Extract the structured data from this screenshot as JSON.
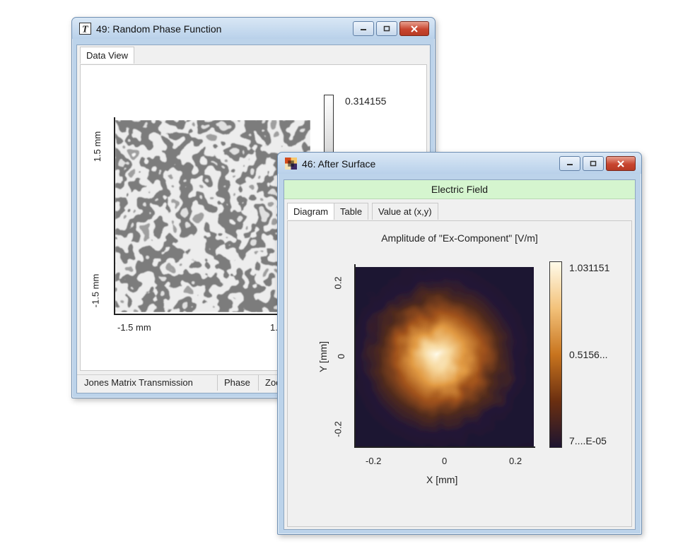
{
  "window_back": {
    "title": "49: Random Phase Function",
    "tab": "Data View",
    "colorbar_max": "0.314155",
    "y_tick_top": "1.5 mm",
    "y_tick_bottom": "-1.5 mm",
    "x_tick_left": "-1.5 mm",
    "x_tick_right": "1.5",
    "status": [
      "Jones Matrix Transmission",
      "Phase",
      "Zoo"
    ]
  },
  "window_front": {
    "title": "46: After Surface",
    "banner": "Electric Field",
    "tabs": [
      "Diagram",
      "Table",
      "Value at (x,y)"
    ],
    "chart_data": {
      "type": "heatmap",
      "title": "Amplitude of \"Ex-Component\"  [V/m]",
      "xlabel": "X [mm]",
      "ylabel": "Y [mm]",
      "xlim": [
        -0.25,
        0.25
      ],
      "ylim": [
        -0.25,
        0.25
      ],
      "x_ticks": [
        "-0.2",
        "0",
        "0.2"
      ],
      "y_ticks": [
        "0.2",
        "0",
        "-0.2"
      ],
      "colorbar_labels": [
        "1.031151",
        "0.5156...",
        "7....E-05"
      ],
      "colormap": [
        "#1d1430",
        "#6b2f10",
        "#c8741e",
        "#f3c27a",
        "#fffbea"
      ],
      "peak": {
        "x": -0.01,
        "y": 0.0,
        "value": 1.031151
      }
    }
  },
  "colors": {
    "title_bar": "#bcd3ea",
    "banner": "#d5f5cf",
    "close_button": "#c8452f"
  }
}
